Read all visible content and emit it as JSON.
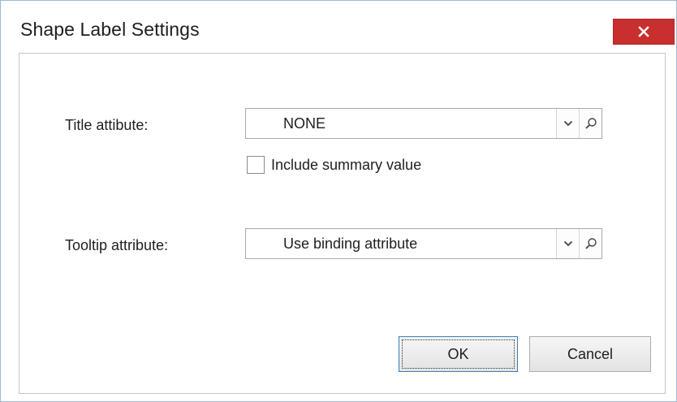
{
  "window": {
    "title": "Shape Label Settings",
    "close_icon": "close-icon",
    "colors": {
      "close_button": "#c7302e",
      "border": "#9fb7d3",
      "default_button_border": "#3c7fb1"
    }
  },
  "title_attribute": {
    "label": "Title attibute:",
    "value": "NONE",
    "dropdown_icon": "chevron-down-icon",
    "search_icon": "search-icon"
  },
  "include_summary": {
    "label": "Include summary value",
    "checked": false
  },
  "tooltip_attribute": {
    "label": "Tooltip attribute:",
    "value": "Use binding attribute",
    "dropdown_icon": "chevron-down-icon",
    "search_icon": "search-icon"
  },
  "buttons": {
    "ok": "OK",
    "cancel": "Cancel"
  }
}
